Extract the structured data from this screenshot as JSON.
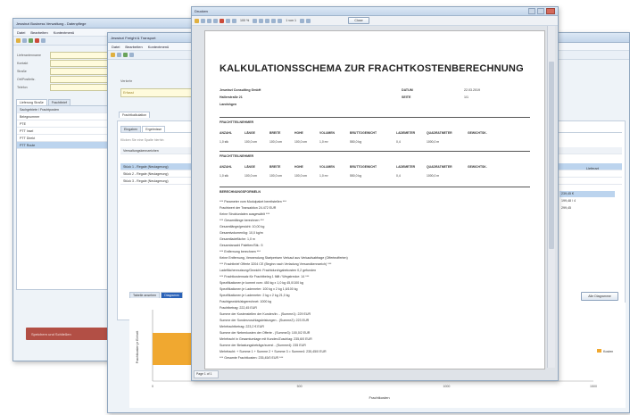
{
  "win1": {
    "title": "Jeswinzi Business Verwaltung - Datenpflege ",
    "menu": [
      "Datei",
      "Bearbeiten",
      "Kontextmenü"
    ],
    "fields": [
      "Lieferantenname",
      "Kontakt",
      "Straße",
      "Ort/Postleitz.",
      "Telefon",
      "Postfach"
    ],
    "tabs": [
      "Lieferung Straße",
      "Frachtbrief"
    ],
    "grid_header": "Sachgebiete / Frachtposten",
    "tree": [
      "Belegnummer",
      "PTE",
      "PTT Insel",
      "PTT Direkt",
      "PTT Route"
    ],
    "status": "Speichern und Schließen"
  },
  "win2": {
    "title": "Jeswinzi Freight & Transport",
    "menu": [
      "Datei",
      "Bearbeiten",
      "Kontextmenü"
    ],
    "field_label": "Verkehr",
    "field_value": "Erfasst",
    "section_tab": "Frachtkalkulation",
    "tabs": [
      "Eingaben",
      "Ergebnisse"
    ],
    "list_hint": "Klicken Sie eine Spalte hierhin",
    "group_label": "Verwaltungskennzeichen",
    "rows": [
      "Stück 1 - Regale (Neulagerung)",
      "Stück 2 - Regale (Neulagerung)",
      "Stück 3 - Regale (Neulagerung)"
    ],
    "right_values": [
      "239,45 €",
      "199,48 / 4",
      "299,45"
    ],
    "right_toggle": "Lieferart",
    "chart_tabs": [
      "Tabelle ansehen",
      "Diagramm"
    ],
    "chart_button": "Alle Diagramme",
    "chart_xlabel": "Frachtkosten",
    "chart_ylabel": "Frachtkosten je Einheit",
    "chart_xticks": [
      "0",
      "500",
      "1000",
      "1500"
    ],
    "legend": "Kosten"
  },
  "viewer": {
    "title": "Drucken",
    "zoom": "100 %",
    "page_nav": "1 von 1",
    "close_label": "Close",
    "page_indicator": "Page 1 of 1",
    "doc": {
      "heading": "KALKULATIONSSCHEMA ZUR FRACHTKOSTENBERECHNUNG",
      "company": "Jeswinzi Consulting GmbH",
      "street": "Hallerstraße 21",
      "city": "Landshgen",
      "datum_label": "DATUM",
      "datum_value": "22.03.2019",
      "seite_label": "SEITE",
      "seite_value": "1/1",
      "section1": "FRACHTTEILNEHMER",
      "section2": "FRACHTTEILNEHMER",
      "columns": [
        "ANZAHL",
        "LÄNGE",
        "BREITE",
        "HÖHE",
        "VOLUMEN",
        "BRUTTOGEWICHT",
        "LADEMETER",
        "QUADRATMETER",
        "GEWICHTSK."
      ],
      "row1": [
        "1,0 stk",
        "100,0 cm",
        "100,0 cm",
        "100,0 cm",
        "1,0 m³",
        "550,0 kg",
        "0,4",
        "1000,0 m",
        ""
      ],
      "row2": [
        "1,0 stk",
        "100,0 cm",
        "100,0 cm",
        "100,0 cm",
        "1,0 m³",
        "550,0 kg",
        "0,4",
        "1000,0 m",
        ""
      ],
      "section3": "BERECHNUNGSFORMELN",
      "lines": [
        "*** Parameter vom Modulpaket bereitstellen ***",
        "Frachtwert der Transaktion 24.472 EUR",
        "Keine Strukturdaten ausgewählt ***",
        "*** Gesamtlänge berechnen ***",
        "Gesamtlänge/gewicht: 10,00 kg",
        "Gesamtvolumen/kg: 10,0 kg/m",
        "Gesamtladefläche: 1,0 m",
        "Gesamtanzahl Paletten/Stk.: 5",
        "*** Entfernung berechnen ***",
        "Keine Entfernung, Verwendung Startpreisen Verkauf aus Verkaufsabfrage (Offerteofferten)",
        "*** Frachtbrief Offerte 3204 CE (Beginn nach Verladung Versandkennzeich) ***",
        "Ladeflächennutzung/Gewicht: Frachtdurchgabekosten 0,2 gefunden",
        "*** Frachtkostensatz für Frachtbeleg 1 fällt / Wegstrecke: 14 ***",
        "Spezifikationen je kommt vom: 450 kg x 1,0 kg 45,0/100 kg",
        "Spezifikationen je Lademeter: 100 kg x 2 kg 1,6/100 kg",
        "Spezifikationen je Lademeter: 2 kg x 2 kg 21,0 kg",
        "Frachtgewicht/abgerechnet: 1000 kg",
        "Frachtbetrag: 222,45 EUR",
        "Summe der Kostenstellen der Kunden/in: - (Summe1): 229 EUR",
        "Summe der Sonderzuschlagsleistungen - (SummeZ): 223 EUR",
        "Mehrfrachtbetrag: 223,2 € EUR",
        "Summe der Nebenkosten der Offerte - (Summe3): 100,0/2 EUR",
        "Mehrfracht in Gesamtumlage mit Kunden/Zuschlag: 235,6/0 EUR",
        "Summe der Belastungsbeträge/zuerst - (Summe4): 235 EUR",
        "Mehrfracht: + Summe 1 + Summe 2 + Summe 3 = Summe4: 235,45/0 EUR",
        "*** Gesamte Frachtkosten: 235,45/0 EUR ***"
      ]
    }
  },
  "chart_data": {
    "type": "bar",
    "categories": [
      ""
    ],
    "values": [
      235
    ],
    "xlabel": "Frachtkosten",
    "ylabel": "Frachtkosten je Einheit",
    "xlim": [
      0,
      1500
    ],
    "colors": [
      "#f0a830"
    ]
  },
  "colors": {
    "accent": "#2a62b8",
    "selected": "#bcd4ee",
    "input": "#fffbdc",
    "bar": "#f0a830"
  }
}
